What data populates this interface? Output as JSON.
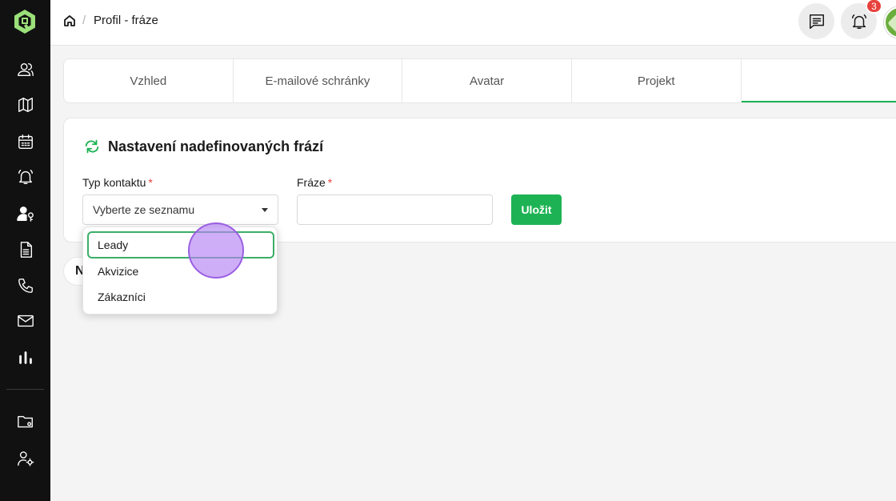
{
  "sidebar": {
    "items": [
      {
        "icon": "users-icon"
      },
      {
        "icon": "map-icon"
      },
      {
        "icon": "calendar-icon"
      },
      {
        "icon": "bell-ring-icon"
      },
      {
        "icon": "user-key-icon"
      },
      {
        "icon": "document-icon"
      },
      {
        "icon": "phone-icon"
      },
      {
        "icon": "mail-icon"
      },
      {
        "icon": "bar-chart-icon"
      },
      {
        "icon": "folder-settings-icon"
      },
      {
        "icon": "user-settings-icon"
      }
    ]
  },
  "header": {
    "breadcrumb_separator": "/",
    "breadcrumb_current": "Profil - fráze",
    "notification_count": "3"
  },
  "tabs": [
    {
      "label": "Vzhled"
    },
    {
      "label": "E-mailové schránky"
    },
    {
      "label": "Avatar"
    },
    {
      "label": "Projekt"
    },
    {
      "label": ""
    }
  ],
  "form": {
    "title": "Nastavení nadefinovaných frází",
    "contact_type_label": "Typ kontaktu",
    "contact_type_placeholder": "Vyberte ze seznamu",
    "phrase_label": "Fráze",
    "phrase_value": "",
    "required_mark": "*",
    "save_label": "Uložit"
  },
  "dropdown": {
    "options": [
      {
        "label": "Leady"
      },
      {
        "label": "Akvizice"
      },
      {
        "label": "Zákazníci"
      }
    ]
  },
  "partial_text": "N",
  "colors": {
    "accent": "#1db354",
    "sidebar_bg": "#111111",
    "badge": "#e8413c",
    "click_indicator": "#b682f5"
  }
}
